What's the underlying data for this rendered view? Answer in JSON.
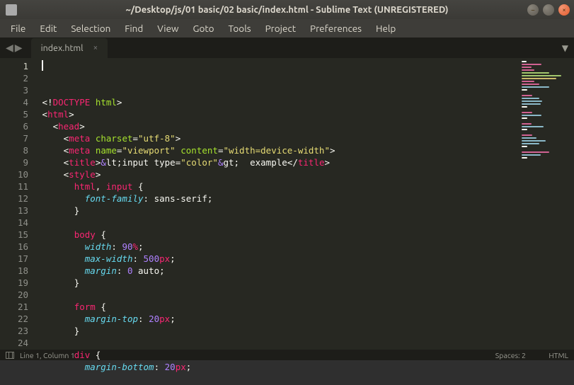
{
  "window": {
    "title": "~/Desktop/js/01 basic/02 basic/index.html - Sublime Text (UNREGISTERED)"
  },
  "menu": {
    "file": "File",
    "edit": "Edit",
    "selection": "Selection",
    "find": "Find",
    "view": "View",
    "goto": "Goto",
    "tools": "Tools",
    "project": "Project",
    "preferences": "Preferences",
    "help": "Help"
  },
  "tab": {
    "name": "index.html",
    "close": "×"
  },
  "gutter": {
    "lines": [
      "1",
      "2",
      "3",
      "4",
      "5",
      "6",
      "7",
      "8",
      "9",
      "10",
      "11",
      "12",
      "13",
      "14",
      "15",
      "16",
      "17",
      "18",
      "19",
      "20",
      "21",
      "22",
      "23",
      "24"
    ]
  },
  "code": {
    "l2": {
      "lt": "<!",
      "doctype": "DOCTYPE ",
      "html": "html",
      "gt": ">"
    },
    "l3": {
      "lt": "<",
      "html": "html",
      "gt": ">"
    },
    "l4": {
      "lt": "<",
      "head": "head",
      "gt": ">"
    },
    "l5": {
      "lt": "<",
      "meta": "meta ",
      "charset": "charset",
      "eq": "=",
      "val": "\"utf-8\"",
      "gt": ">"
    },
    "l6": {
      "lt": "<",
      "meta": "meta ",
      "name": "name",
      "eq": "=",
      "v1": "\"viewport\" ",
      "content": "content",
      "eq2": "=",
      "v2": "\"width=device-width\"",
      "gt": ">"
    },
    "l7": {
      "lt": "<",
      "title": "title",
      "gt": ">",
      "amp1": "&",
      "lt2": "lt;",
      "txt": "input type=",
      "q": "\"color\"",
      "amp2": "&",
      "gt2": "gt; ",
      "ex": " example",
      "lt3": "</",
      "title2": "title",
      "gt3": ">"
    },
    "l8": {
      "lt": "<",
      "style": "style",
      "gt": ">"
    },
    "l9": {
      "sel": "html",
      "comma": ", ",
      "sel2": "input",
      "ob": " {"
    },
    "l10": {
      "prop": "font-family",
      "colon": ": ",
      "val": "sans-serif",
      "semi": ";"
    },
    "l11": {
      "cb": "}"
    },
    "l13": {
      "sel": "body",
      "ob": " {"
    },
    "l14": {
      "prop": "width",
      "colon": ": ",
      "num": "90",
      "unit": "%",
      "semi": ";"
    },
    "l15": {
      "prop": "max-width",
      "colon": ": ",
      "num": "500",
      "unit": "px",
      "semi": ";"
    },
    "l16": {
      "prop": "margin",
      "colon": ": ",
      "num": "0 ",
      "val": "auto",
      "semi": ";"
    },
    "l17": {
      "cb": "}"
    },
    "l19": {
      "sel": "form",
      "ob": " {"
    },
    "l20": {
      "prop": "margin-top",
      "colon": ": ",
      "num": "20",
      "unit": "px",
      "semi": ";"
    },
    "l21": {
      "cb": "}"
    },
    "l23": {
      "sel": "div",
      "ob": " {"
    },
    "l24": {
      "prop": "margin-bottom",
      "colon": ": ",
      "num": "20",
      "unit": "px",
      "semi": ";"
    }
  },
  "status": {
    "pos": "Line 1, Column 1",
    "spaces": "Spaces: 2",
    "syntax": "HTML"
  }
}
